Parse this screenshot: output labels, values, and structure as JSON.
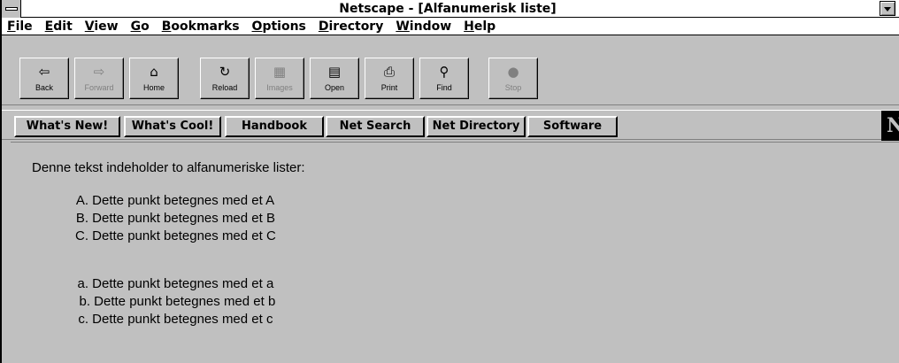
{
  "window": {
    "title": "Netscape - [Alfanumerisk liste]"
  },
  "menubar": {
    "items": [
      {
        "accel": "F",
        "rest": "ile"
      },
      {
        "accel": "E",
        "rest": "dit"
      },
      {
        "accel": "V",
        "rest": "iew"
      },
      {
        "accel": "G",
        "rest": "o"
      },
      {
        "accel": "B",
        "rest": "ookmarks"
      },
      {
        "accel": "O",
        "rest": "ptions"
      },
      {
        "accel": "D",
        "rest": "irectory"
      },
      {
        "accel": "W",
        "rest": "indow"
      },
      {
        "accel": "H",
        "rest": "elp"
      }
    ]
  },
  "toolbar": {
    "back": {
      "label": "Back",
      "icon": "⇦"
    },
    "forward": {
      "label": "Forward",
      "icon": "⇨"
    },
    "home": {
      "label": "Home",
      "icon": "⌂"
    },
    "reload": {
      "label": "Reload",
      "icon": "↻"
    },
    "images": {
      "label": "Images",
      "icon": "▦"
    },
    "open": {
      "label": "Open",
      "icon": "▤"
    },
    "print": {
      "label": "Print",
      "icon": "⎙"
    },
    "find": {
      "label": "Find",
      "icon": "⚲"
    },
    "stop": {
      "label": "Stop",
      "icon": "●"
    }
  },
  "directory_buttons": {
    "whats_new": "What's New!",
    "whats_cool": "What's Cool!",
    "handbook": "Handbook",
    "net_search": "Net Search",
    "net_directory": "Net Directory",
    "software": "Software"
  },
  "logo": {
    "letter": "N"
  },
  "content": {
    "intro": "Denne tekst indeholder to alfanumeriske lister:",
    "list_upper": [
      {
        "marker": "A.",
        "text": "Dette punkt betegnes med et A"
      },
      {
        "marker": "B.",
        "text": "Dette punkt betegnes med et B"
      },
      {
        "marker": "C.",
        "text": "Dette punkt betegnes med et C"
      }
    ],
    "list_lower": [
      {
        "marker": "a.",
        "text": "Dette punkt betegnes med et a"
      },
      {
        "marker": "b.",
        "text": "Dette punkt betegnes med et b"
      },
      {
        "marker": "c.",
        "text": "Dette punkt betegnes med et c"
      }
    ]
  }
}
